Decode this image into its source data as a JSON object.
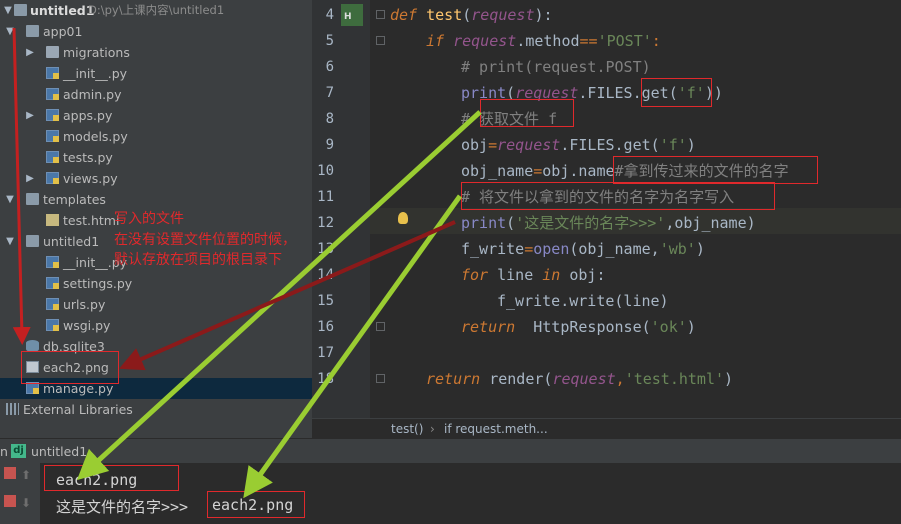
{
  "project": {
    "root_name": "untitled1",
    "root_path": "D:\\py\\上课内容\\untitled1",
    "items": [
      {
        "label": "app01",
        "kind": "folder",
        "expanded": true
      },
      {
        "label": "migrations",
        "kind": "package",
        "expanded": false
      },
      {
        "label": "__init__.py",
        "kind": "py"
      },
      {
        "label": "admin.py",
        "kind": "py"
      },
      {
        "label": "apps.py",
        "kind": "py",
        "expanded": false
      },
      {
        "label": "models.py",
        "kind": "py"
      },
      {
        "label": "tests.py",
        "kind": "py"
      },
      {
        "label": "views.py",
        "kind": "py",
        "expanded": false
      },
      {
        "label": "templates",
        "kind": "folder",
        "expanded": true
      },
      {
        "label": "test.html",
        "kind": "html"
      },
      {
        "label": "untitled1",
        "kind": "folder",
        "expanded": true
      },
      {
        "label": "__init__.py",
        "kind": "py"
      },
      {
        "label": "settings.py",
        "kind": "py"
      },
      {
        "label": "urls.py",
        "kind": "py"
      },
      {
        "label": "wsgi.py",
        "kind": "py"
      },
      {
        "label": "db.sqlite3",
        "kind": "db"
      },
      {
        "label": "each2.png",
        "kind": "png"
      },
      {
        "label": "manage.py",
        "kind": "py",
        "selected": true
      },
      {
        "label": "External Libraries",
        "kind": "lib"
      }
    ]
  },
  "editor": {
    "line_numbers": [
      "4",
      "5",
      "6",
      "7",
      "8",
      "9",
      "10",
      "11",
      "12",
      "13",
      "14",
      "15",
      "16",
      "17",
      "18"
    ],
    "breadcrumb": [
      "test()",
      "if request.meth..."
    ],
    "code": {
      "l4": {
        "kw": "def",
        "fn": "test",
        "open": "(",
        "par": "request",
        "close": "):"
      },
      "l5": {
        "kw": "if",
        "par": "request",
        "rest": ".method",
        "op": "==",
        "str": "'POST'",
        "tail": ":"
      },
      "l6": {
        "cm": "# print(request.POST)"
      },
      "l7": {
        "fn": "print",
        "open": "(",
        "par": "request",
        "rest": ".FILES.get(",
        "str": "'f'",
        "tail": "))"
      },
      "l8": {
        "cm": "# 获取文件 f"
      },
      "l9": {
        "a": "obj",
        "op": "=",
        "par": "request",
        "rest": ".FILES.get(",
        "str": "'f'",
        "tail": ")"
      },
      "l10": {
        "a": "obj_name",
        "op": "=",
        "b": "obj.name",
        "cm": "#拿到传过来的文件的名字"
      },
      "l11": {
        "cm": "# 将文件以拿到的文件的名字为名字写入"
      },
      "l12": {
        "fn": "print",
        "open": "(",
        "str": "'这是文件的名字>>>'",
        "tail": ",obj_name)"
      },
      "l13": {
        "a": "f_write",
        "op": "=",
        "fn": "open",
        "b": "(obj_name,",
        "str": "'wb'",
        "tail": ")"
      },
      "l14": {
        "kw": "for",
        "a": " line ",
        "kw2": "in",
        "b": " obj:"
      },
      "l15": {
        "a": "f_write.write(line)"
      },
      "l16": {
        "kw": "return",
        "a": "  HttpResponse(",
        "str": "'ok'",
        "tail": ")"
      },
      "l18": {
        "kw": "return",
        "a": " render(",
        "par": "request",
        "op": ",",
        "str": "'test.html'",
        "tail": ")"
      }
    }
  },
  "run": {
    "title": "untitled1",
    "output_line1": "each2.png",
    "output_line2_prefix": "这是文件的名字>>>",
    "output_line2_value": "each2.png"
  },
  "annotation": {
    "line1": "写入的文件",
    "line2": "在没有设置文件位置的时候，",
    "line3": "默认存放在项目的根目录下"
  },
  "colors": {
    "annotation_red": "#e0292c",
    "arrow_green": "#9acd32",
    "arrow_darkred": "#8b1a1a"
  }
}
